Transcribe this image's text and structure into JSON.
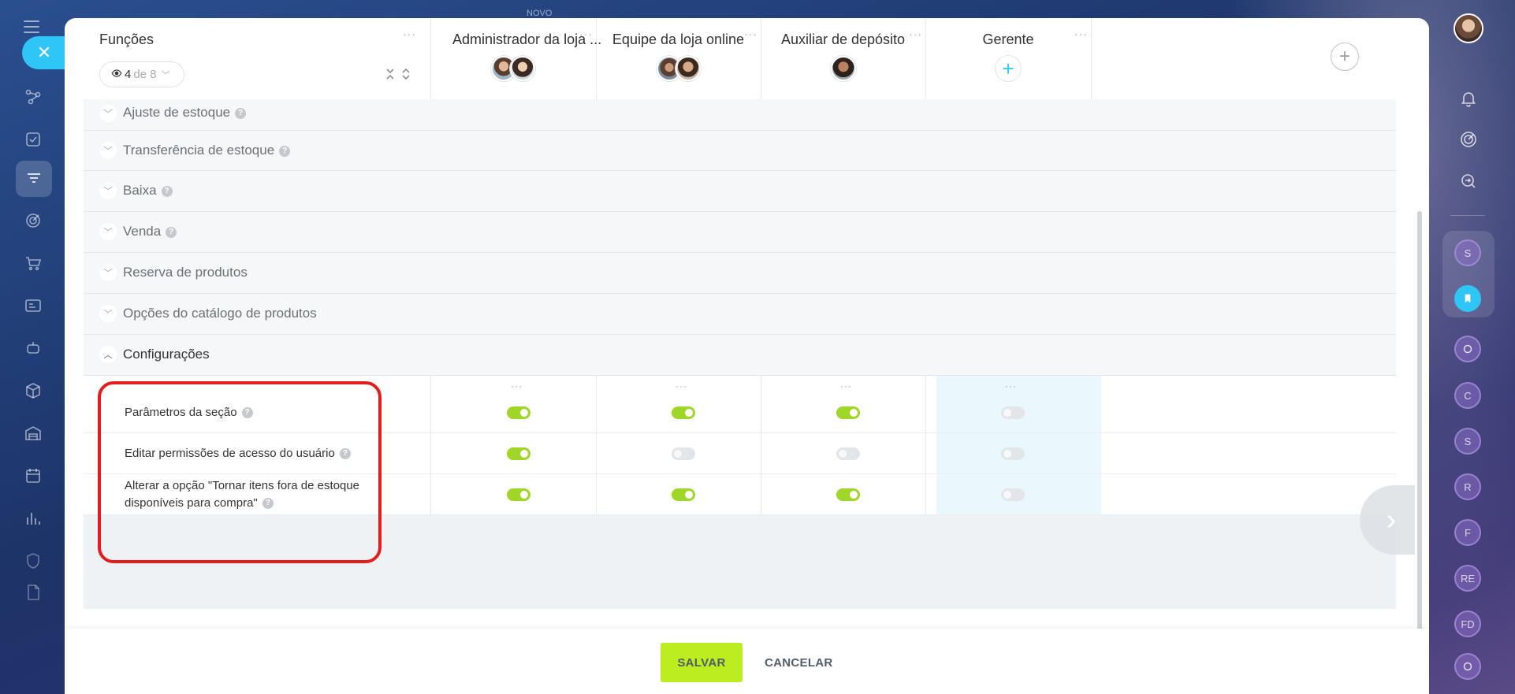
{
  "topbar": {
    "novo_label": "NOVO"
  },
  "left_rail": {
    "close_label": "✕",
    "icons": [
      "flow-icon",
      "tasks-icon",
      "filter-icon",
      "target-icon",
      "cart-icon",
      "contact-card-icon",
      "robot-icon",
      "cube-icon",
      "warehouse-icon",
      "calendar-icon",
      "chart-icon",
      "shield-icon",
      "document-icon"
    ]
  },
  "right_rail": {
    "circles": [
      "S",
      "",
      "",
      "C",
      "S",
      "R",
      "F",
      "RE",
      "FD",
      ""
    ]
  },
  "roles_panel": {
    "title": "Funções",
    "visible_count": "4",
    "of_total": "de 8",
    "more": "···"
  },
  "roles": [
    {
      "name": "Administrador da loja ...",
      "more": "···"
    },
    {
      "name": "Equipe da loja online",
      "more": "···"
    },
    {
      "name": "Auxiliar de depósito",
      "more": "···"
    },
    {
      "name": "Gerente",
      "more": "···"
    }
  ],
  "sections": [
    {
      "label": "Ajuste de estoque",
      "help": true
    },
    {
      "label": "Transferência de estoque",
      "help": true
    },
    {
      "label": "Baixa",
      "help": true
    },
    {
      "label": "Venda",
      "help": true
    },
    {
      "label": "Reserva de produtos",
      "help": false
    },
    {
      "label": "Opções do catálogo de produtos",
      "help": false
    }
  ],
  "open_section": {
    "label": "Configurações"
  },
  "column_dots": "···",
  "permissions": [
    {
      "label": "Parâmetros da seção",
      "values": [
        true,
        true,
        true,
        false
      ]
    },
    {
      "label": "Editar permissões de acesso do usuário",
      "values": [
        true,
        false,
        false,
        false
      ]
    },
    {
      "label_line1": "Alterar a opção \"Tornar itens fora de estoque",
      "label_line2": "disponíveis para compra\"",
      "values": [
        true,
        true,
        true,
        false
      ]
    }
  ],
  "footer": {
    "save_label": "SALVAR",
    "cancel_label": "CANCELAR"
  },
  "colors": {
    "toggle_on": "#9fd628",
    "toggle_off": "#e3e6e8",
    "save_button": "#bbed21",
    "accent": "#2fc6f6",
    "highlight": "#e41c1c"
  }
}
